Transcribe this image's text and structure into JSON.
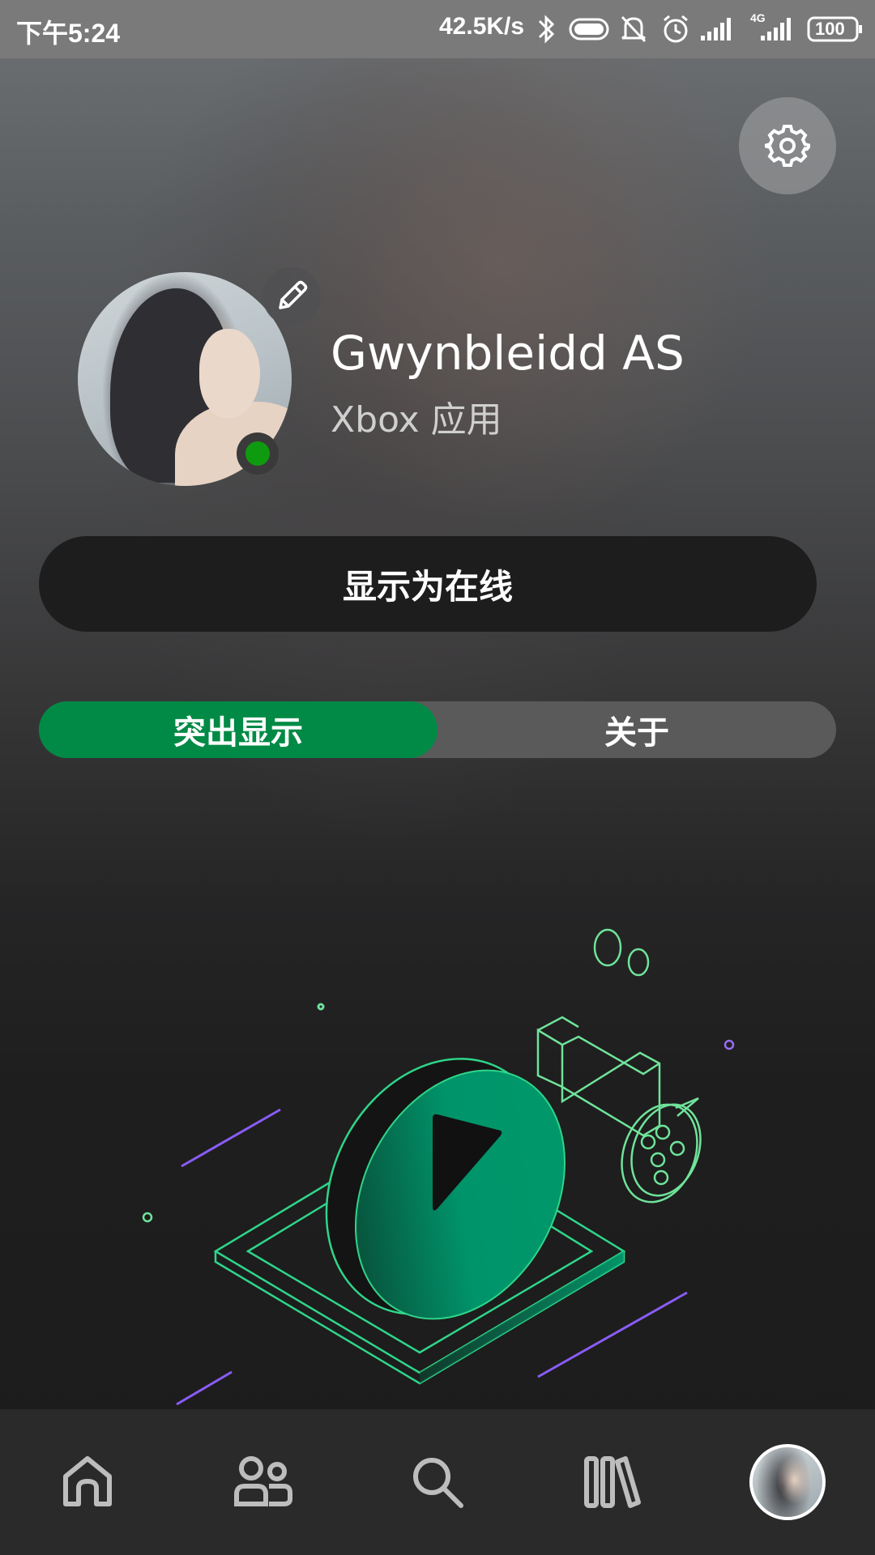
{
  "status_bar": {
    "time": "下午5:24",
    "net_rate": "42.5K/s",
    "network_type": "4G",
    "battery": "100",
    "icons": [
      "bluetooth-icon",
      "toggle-icon",
      "mute-icon",
      "alarm-icon",
      "signal-icon",
      "signal-4g-icon",
      "battery-icon"
    ]
  },
  "profile": {
    "gamertag": "Gwynbleidd AS",
    "subtitle": "Xbox 应用",
    "presence_color": "#0f9b0f"
  },
  "actions": {
    "online_button_label": "显示为在线"
  },
  "tabs": [
    {
      "label": "突出显示",
      "active": true
    },
    {
      "label": "关于",
      "active": false
    }
  ],
  "colors": {
    "accent": "#008a45",
    "illustration_green": "#2fd58a",
    "illustration_purple": "#8a5cf5"
  },
  "bottom_nav": {
    "items": [
      "home-icon",
      "friends-icon",
      "search-icon",
      "library-icon",
      "profile-avatar"
    ],
    "active": "profile-avatar"
  }
}
